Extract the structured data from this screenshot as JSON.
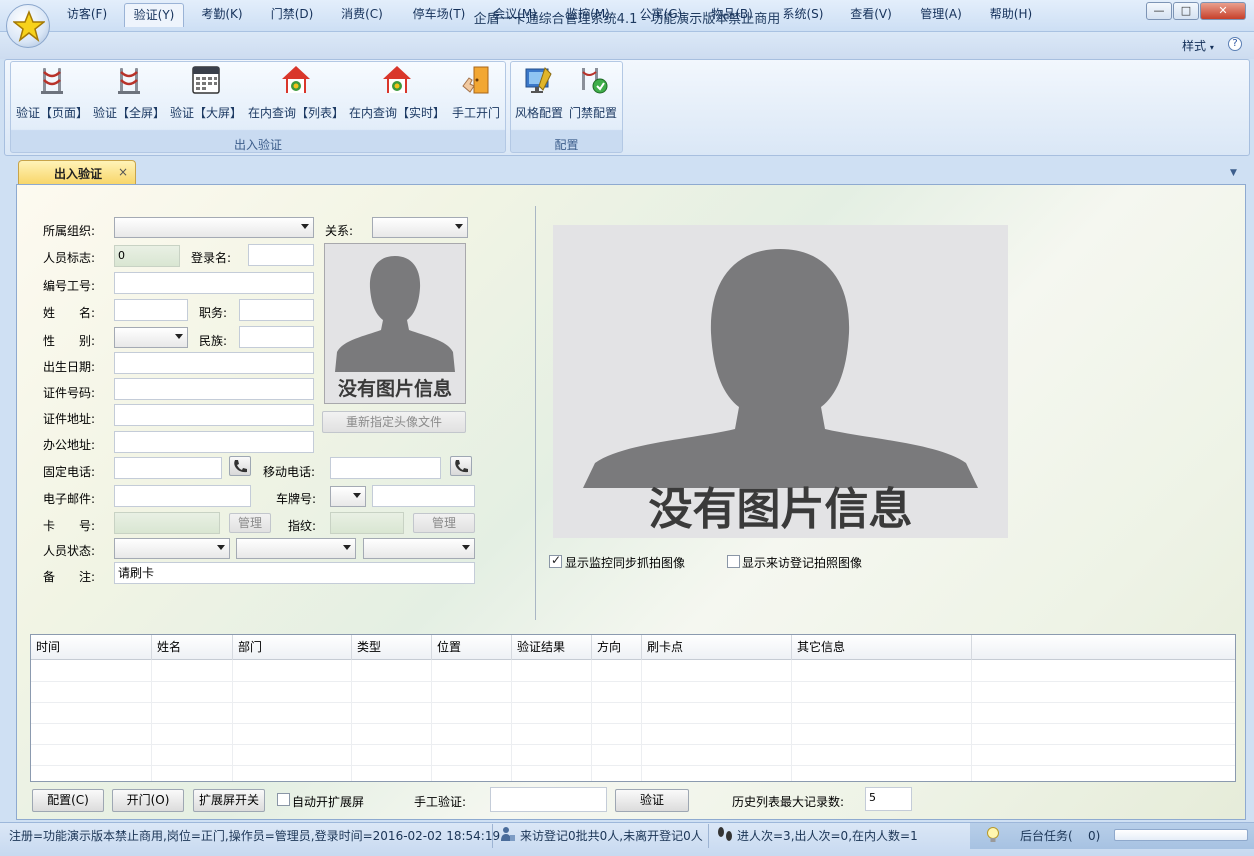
{
  "window": {
    "title": "企盾一卡通综合管理系统4.1 - 功能演示版本禁止商用",
    "controls": {
      "minimize": "—",
      "maximize": "□",
      "close": "✕"
    }
  },
  "menu": {
    "tabs": [
      "访客(F)",
      "验证(Y)",
      "考勤(K)",
      "门禁(D)",
      "消费(C)",
      "停车场(T)",
      "会议(M)",
      "监控(M)",
      "公寓(G)",
      "物品(B)",
      "系统(S)",
      "查看(V)",
      "管理(A)",
      "帮助(H)"
    ],
    "active_index": 1,
    "style_label": "样式",
    "help_glyph": "?"
  },
  "ribbon": {
    "groups": [
      {
        "label": "出入验证",
        "buttons": [
          {
            "label": "验证【页面】",
            "icon": "turnstile-icon"
          },
          {
            "label": "验证【全屏】",
            "icon": "turnstile-icon"
          },
          {
            "label": "验证【大屏】",
            "icon": "calendar-screen-icon"
          },
          {
            "label": "在内查询【列表】",
            "icon": "house-icon"
          },
          {
            "label": "在内查询【实时】",
            "icon": "house-icon"
          },
          {
            "label": "手工开门",
            "icon": "hand-door-icon"
          }
        ]
      },
      {
        "label": "配置",
        "buttons": [
          {
            "label": "风格配置",
            "icon": "style-config-icon"
          },
          {
            "label": "门禁配置",
            "icon": "door-config-icon"
          }
        ]
      }
    ]
  },
  "doc_tab": {
    "label": "出入验证",
    "close": "×",
    "dropdown": "▼"
  },
  "form": {
    "org_label": "所属组织:",
    "relation_label": "关系:",
    "person_id_label": "人员标志:",
    "person_id_value": "0",
    "login_label": "登录名:",
    "staff_no_label": "编号工号:",
    "name_label": "姓　　名:",
    "position_label": "职务:",
    "gender_label": "性　　别:",
    "ethnic_label": "民族:",
    "birth_label": "出生日期:",
    "id_no_label": "证件号码:",
    "id_addr_label": "证件地址:",
    "office_addr_label": "办公地址:",
    "phone_label": "固定电话:",
    "mobile_label": "移动电话:",
    "email_label": "电子邮件:",
    "plate_label": "车牌号:",
    "card_label": "卡　　号:",
    "card_manage": "管理",
    "fingerprint_label": "指纹:",
    "fingerprint_manage": "管理",
    "status_label": "人员状态:",
    "remark_label": "备　　注:",
    "remark_value": "请刷卡",
    "photo_caption": "没有图片信息",
    "reassign_button": "重新指定头像文件"
  },
  "camera": {
    "caption": "没有图片信息",
    "show_monitor_label": "显示监控同步抓拍图像",
    "show_monitor_checked": true,
    "show_visitor_label": "显示来访登记拍照图像",
    "show_visitor_checked": false
  },
  "grid": {
    "columns": [
      "时间",
      "姓名",
      "部门",
      "类型",
      "位置",
      "验证结果",
      "方向",
      "刷卡点",
      "其它信息"
    ],
    "rows": []
  },
  "bottom": {
    "config_button": "配置(C)",
    "open_button": "开门(O)",
    "ext_screen_button": "扩展屏开关",
    "auto_ext_label": "自动开扩展屏",
    "auto_ext_checked": false,
    "manual_label": "手工验证:",
    "manual_value": "",
    "verify_button": "验证",
    "max_records_label": "历史列表最大记录数:",
    "max_records_value": "5"
  },
  "statusbar": {
    "info": "注册=功能演示版本禁止商用,岗位=正门,操作员=管理员,登录时间=2016-02-02 18:54:19",
    "visitor": "来访登记0批共0人,未离开登记0人",
    "inout": "进人次=3,出人次=0,在内人数=1",
    "tasks": "后台任务(",
    "tasks_count": "0)"
  },
  "colors": {
    "accent": "#cfe0f3",
    "doc_tab": "#f8d66a"
  }
}
